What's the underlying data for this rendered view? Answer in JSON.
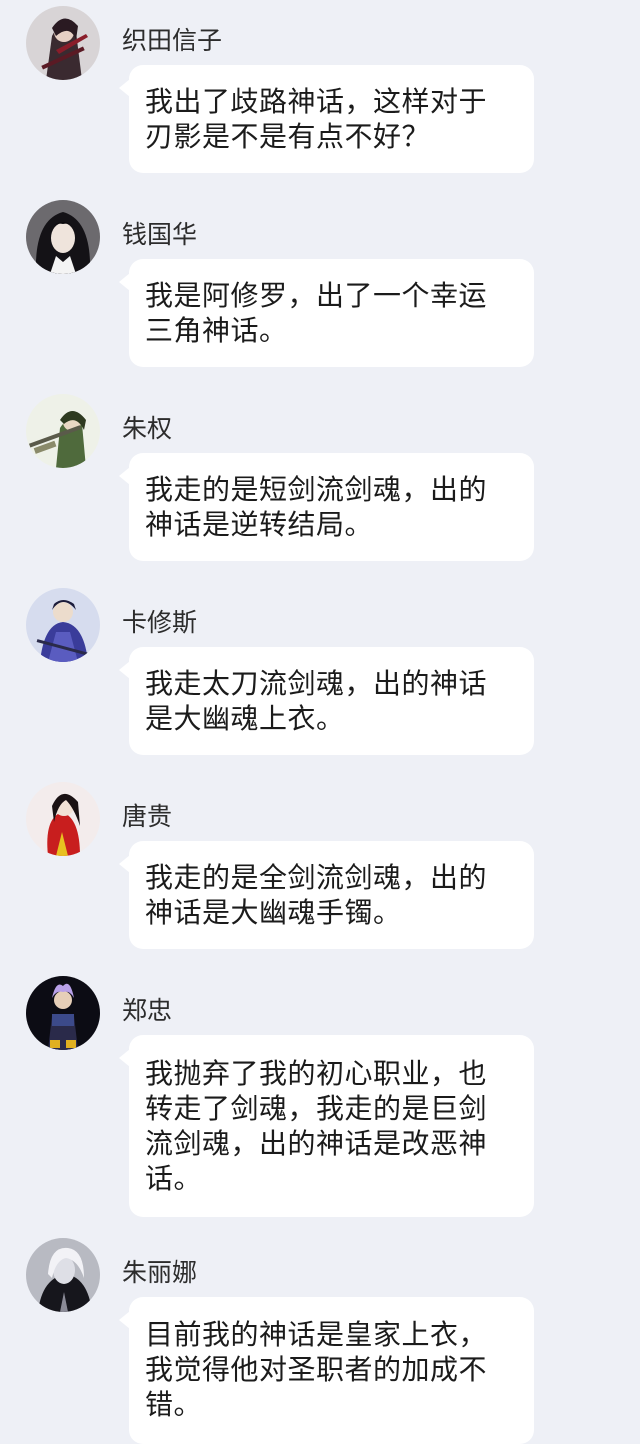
{
  "messages": [
    {
      "sender": "织田信子",
      "avatar_icon": "avatar-dark-swordsman-icon",
      "lines": [
        "我出了歧路神话，这样对于",
        "刃影是不是有点不好？"
      ]
    },
    {
      "sender": "钱国华",
      "avatar_icon": "avatar-dark-haired-man-icon",
      "lines": [
        "我是阿修罗，出了一个幸运",
        "三角神话。"
      ]
    },
    {
      "sender": "朱权",
      "avatar_icon": "avatar-green-samurai-icon",
      "lines": [
        "我走的是短剑流剑魂，出的",
        "神话是逆转结局。"
      ]
    },
    {
      "sender": "卡修斯",
      "avatar_icon": "avatar-blue-robed-swordsman-icon",
      "lines": [
        "我走太刀流剑魂，出的神话",
        "是大幽魂上衣。"
      ]
    },
    {
      "sender": "唐贵",
      "avatar_icon": "avatar-red-robed-lady-icon",
      "lines": [
        "我走的是全剑流剑魂，出的",
        "神话是大幽魂手镯。"
      ]
    },
    {
      "sender": "郑忠",
      "avatar_icon": "avatar-purple-haired-warrior-icon",
      "lines": [
        "我抛弃了我的初心职业，也",
        "转走了剑魂，我走的是巨剑",
        "流剑魂，出的神话是改恶神",
        "话。"
      ]
    },
    {
      "sender": "朱丽娜",
      "avatar_icon": "avatar-white-haired-figure-icon",
      "lines": [
        "目前我的神话是皇家上衣，",
        "我觉得他对圣职者的加成不",
        "错。"
      ]
    }
  ],
  "colors": {
    "background": "#eef0f6",
    "bubble": "#ffffff",
    "text": "#1b1b1b"
  }
}
